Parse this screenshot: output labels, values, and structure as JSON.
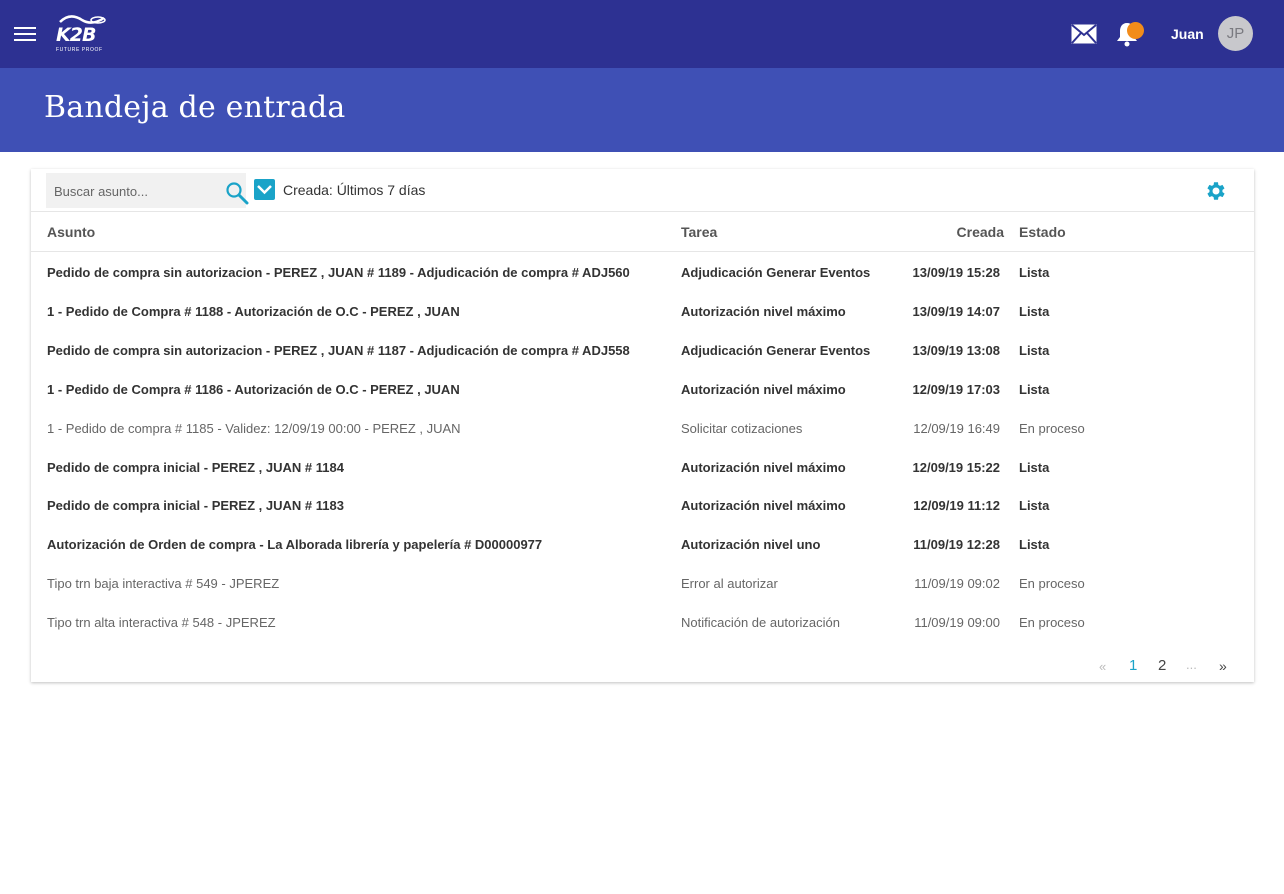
{
  "app": {
    "logo_text": "K2B",
    "logo_tagline": "FUTURE PROOF",
    "user_name": "Juan",
    "user_initials": "JP"
  },
  "page": {
    "title": "Bandeja de entrada"
  },
  "toolbar": {
    "search_placeholder": "Buscar asunto...",
    "filter_label": "Creada: Últimos 7 días"
  },
  "table": {
    "headers": {
      "asunto": "Asunto",
      "tarea": "Tarea",
      "creada": "Creada",
      "estado": "Estado"
    },
    "rows": [
      {
        "asunto": "Pedido de compra sin autorizacion - PEREZ , JUAN # 1189 - Adjudicación de compra # ADJ560",
        "tarea": "Adjudicación Generar Eventos",
        "creada": "13/09/19 15:28",
        "estado": "Lista",
        "unread": true
      },
      {
        "asunto": "1 - Pedido de Compra # 1188 - Autorización de O.C - PEREZ , JUAN",
        "tarea": "Autorización nivel máximo",
        "creada": "13/09/19 14:07",
        "estado": "Lista",
        "unread": true
      },
      {
        "asunto": "Pedido de compra sin autorizacion - PEREZ , JUAN # 1187 - Adjudicación de compra # ADJ558",
        "tarea": "Adjudicación Generar Eventos",
        "creada": "13/09/19 13:08",
        "estado": "Lista",
        "unread": true
      },
      {
        "asunto": "1 - Pedido de Compra # 1186 - Autorización de O.C - PEREZ , JUAN",
        "tarea": "Autorización nivel máximo",
        "creada": "12/09/19 17:03",
        "estado": "Lista",
        "unread": true
      },
      {
        "asunto": "1 - Pedido de compra # 1185 - Validez: 12/09/19 00:00 - PEREZ , JUAN",
        "tarea": "Solicitar cotizaciones",
        "creada": "12/09/19 16:49",
        "estado": "En proceso",
        "unread": false
      },
      {
        "asunto": "Pedido de compra inicial - PEREZ , JUAN # 1184",
        "tarea": "Autorización nivel máximo",
        "creada": "12/09/19 15:22",
        "estado": "Lista",
        "unread": true
      },
      {
        "asunto": "Pedido de compra inicial - PEREZ , JUAN # 1183",
        "tarea": "Autorización nivel máximo",
        "creada": "12/09/19 11:12",
        "estado": "Lista",
        "unread": true
      },
      {
        "asunto": "Autorización de Orden de compra - La Alborada librería y papelería # D00000977",
        "tarea": "Autorización nivel uno",
        "creada": "11/09/19 12:28",
        "estado": "Lista",
        "unread": true
      },
      {
        "asunto": "Tipo trn baja interactiva # 549 - JPEREZ",
        "tarea": "Error al autorizar",
        "creada": "11/09/19 09:02",
        "estado": "En proceso",
        "unread": false
      },
      {
        "asunto": "Tipo trn alta interactiva # 548 - JPEREZ",
        "tarea": "Notificación de autorización",
        "creada": "11/09/19 09:00",
        "estado": "En proceso",
        "unread": false
      }
    ]
  },
  "pagination": {
    "prev": "«",
    "page1": "1",
    "page2": "2",
    "ellipsis": "...",
    "next": "»"
  },
  "colors": {
    "topbar": "#2d3192",
    "titlebar": "#3f50b5",
    "accent": "#1aa3c8",
    "notification": "#f28c1a"
  }
}
